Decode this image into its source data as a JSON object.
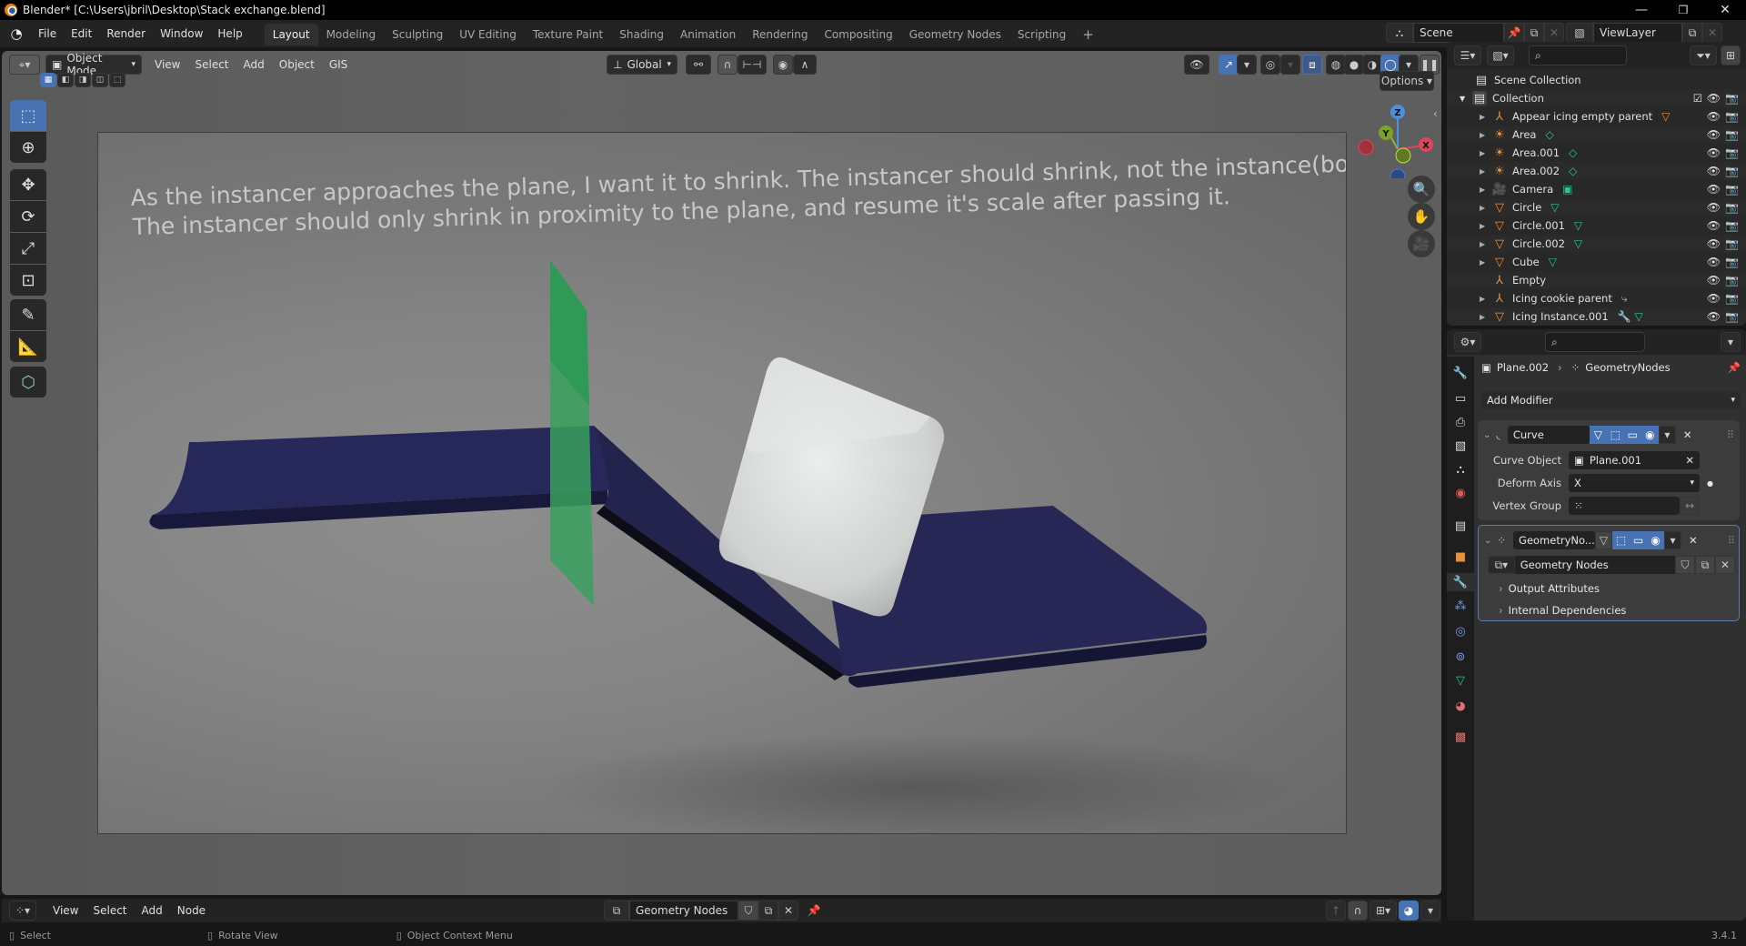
{
  "window": {
    "title": "Blender* [C:\\Users\\jbril\\Desktop\\Stack exchange.blend]",
    "controls": [
      "minimize",
      "maximize",
      "close"
    ]
  },
  "menu": {
    "items": [
      "File",
      "Edit",
      "Render",
      "Window",
      "Help"
    ]
  },
  "workspaces": {
    "active": "Layout",
    "tabs": [
      "Layout",
      "Modeling",
      "Sculpting",
      "UV Editing",
      "Texture Paint",
      "Shading",
      "Animation",
      "Rendering",
      "Compositing",
      "Geometry Nodes",
      "Scripting"
    ],
    "add_label": "+"
  },
  "scene": {
    "scene_name": "Scene",
    "view_layer": "ViewLayer"
  },
  "viewport_header": {
    "mode": "Object Mode",
    "menus": [
      "View",
      "Select",
      "Add",
      "Object",
      "GIS"
    ],
    "orientation": "Global",
    "options_label": "Options"
  },
  "viewport": {
    "overlay_text_line1": "As the instancer approaches the plane, I want it to shrink. The instancer should shrink, not the instance(box).",
    "overlay_text_line2": "The instancer should only shrink in proximity to the plane, and resume it's scale after passing it.",
    "gizmo_axes": {
      "x": "X",
      "y": "Y",
      "z": "Z"
    },
    "colors": {
      "plane": "#25264f",
      "cutter": "#3aa05e",
      "cube": "#d7d9d8"
    }
  },
  "toolbar": {
    "tools": [
      "select-box",
      "cursor",
      "move",
      "rotate",
      "scale",
      "transform",
      "annotate",
      "measure",
      "add-cube"
    ]
  },
  "node_editor_header": {
    "menus": [
      "View",
      "Select",
      "Add",
      "Node"
    ],
    "node_tree": "Geometry Nodes"
  },
  "statusbar": {
    "hints": [
      "Select",
      "Rotate View",
      "Object Context Menu"
    ],
    "version": "3.4.1"
  },
  "outliner": {
    "root": "Scene Collection",
    "collection": "Collection",
    "items": [
      {
        "name": "Appear icing empty parent",
        "type": "empty",
        "extra": "mesh-orange"
      },
      {
        "name": "Area",
        "type": "light",
        "extra": "light-data"
      },
      {
        "name": "Area.001",
        "type": "light",
        "extra": "light-data"
      },
      {
        "name": "Area.002",
        "type": "light",
        "extra": "light-data"
      },
      {
        "name": "Camera",
        "type": "camera",
        "extra": "camera-data"
      },
      {
        "name": "Circle",
        "type": "mesh",
        "extra": "mesh-data"
      },
      {
        "name": "Circle.001",
        "type": "mesh",
        "extra": "mesh-data"
      },
      {
        "name": "Circle.002",
        "type": "mesh",
        "extra": "mesh-data"
      },
      {
        "name": "Cube",
        "type": "mesh",
        "extra": "mesh-data"
      },
      {
        "name": "Empty",
        "type": "empty",
        "extra": ""
      },
      {
        "name": "Icing cookie parent",
        "type": "empty",
        "extra": "constraint"
      },
      {
        "name": "Icing Instance.001",
        "type": "mesh",
        "extra": "modifier+mesh"
      }
    ]
  },
  "properties": {
    "breadcrumb_object": "Plane.002",
    "breadcrumb_modifier": "GeometryNodes",
    "add_modifier_label": "Add Modifier",
    "modifiers": [
      {
        "name": "Curve",
        "fields": [
          {
            "label": "Curve Object",
            "value": "Plane.001"
          },
          {
            "label": "Deform Axis",
            "value": "X"
          },
          {
            "label": "Vertex Group",
            "value": ""
          }
        ]
      },
      {
        "name": "GeometryNo...",
        "node_group": "Geometry Nodes",
        "panels": [
          "Output Attributes",
          "Internal Dependencies"
        ]
      }
    ]
  }
}
